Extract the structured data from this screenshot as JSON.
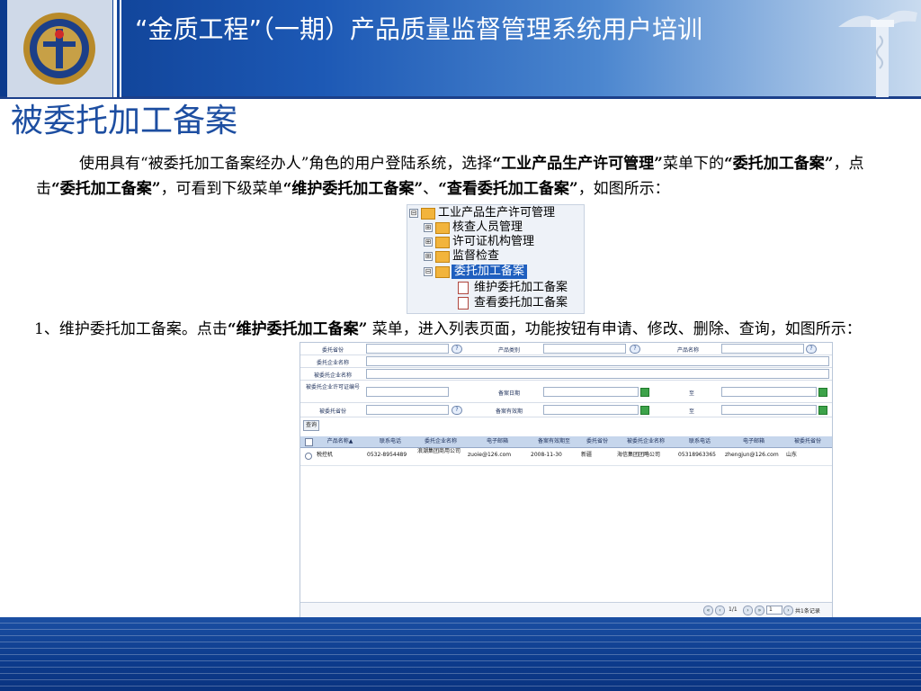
{
  "header": {
    "title": "“金质工程”（一期）产品质量监督管理系统用户培训"
  },
  "page_title": "被委托加工备案",
  "para1": {
    "t1": "使用具有“被委托加工备案经办人”角色的用户登陆系统，选择",
    "b1": "“工业产品生产许可管理”",
    "t2": "菜单下的",
    "b2": "“委托加工备案”",
    "t3": "，点击",
    "b3": "“委托加工备案”",
    "t4": "，可看到下级菜单",
    "b4": "“维护委托加工备案”",
    "t5": "、",
    "b5": "“查看委托加工备案”",
    "t6": "，如图所示："
  },
  "tree": {
    "items": [
      {
        "label": "工业产品生产许可管理",
        "toggle": "⊟"
      },
      {
        "label": "核查人员管理",
        "toggle": "⊞"
      },
      {
        "label": "许可证机构管理",
        "toggle": "⊞"
      },
      {
        "label": "监督检查",
        "toggle": "⊞"
      },
      {
        "label": "委托加工备案",
        "toggle": "⊟"
      },
      {
        "label": "维护委托加工备案"
      },
      {
        "label": "查看委托加工备案"
      }
    ]
  },
  "para2": {
    "t1": "1、维护委托加工备案。点击",
    "b1": "“维护委托加工备案”",
    "t2": " 菜单，进入列表页面，功能按钮有申请、修改、删除、查询，如图所示："
  },
  "shot": {
    "form": {
      "entrust_province": "委托省份",
      "product_category": "产品类别",
      "product_name": "产品名称",
      "entrust_company": "委托企业名称",
      "entrusted_company": "被委托企业名称",
      "entrusted_license": "被委托企业许可证编号",
      "record_date": "备案日期",
      "to1": "至",
      "entrusted_province": "被委托省份",
      "record_valid": "备案有效期",
      "to2": "至",
      "q_glyph": "?"
    },
    "query_button": "查询",
    "columns": [
      "产品名称▲",
      "联系电话",
      "委托企业名称",
      "电子邮箱",
      "备案有效期至",
      "委托省份",
      "被委托企业名称",
      "联系电话",
      "电子邮箱",
      "被委托省份"
    ],
    "row": [
      "税控机",
      "0532-8954489",
      "浪潮集团商用公司",
      "zuoie@126.com",
      "2008-11-30",
      "新疆",
      "海信集团团略公司",
      "05318963365",
      "zhengjun@126.com",
      "山东"
    ],
    "pager": {
      "page": "1/1",
      "input": "1",
      "total": "共1条记录"
    },
    "actions": [
      "申请",
      "修改",
      "删除"
    ]
  },
  "colors": {
    "accent": "#1d4ea1",
    "header_blue": "#0b3a8c"
  }
}
